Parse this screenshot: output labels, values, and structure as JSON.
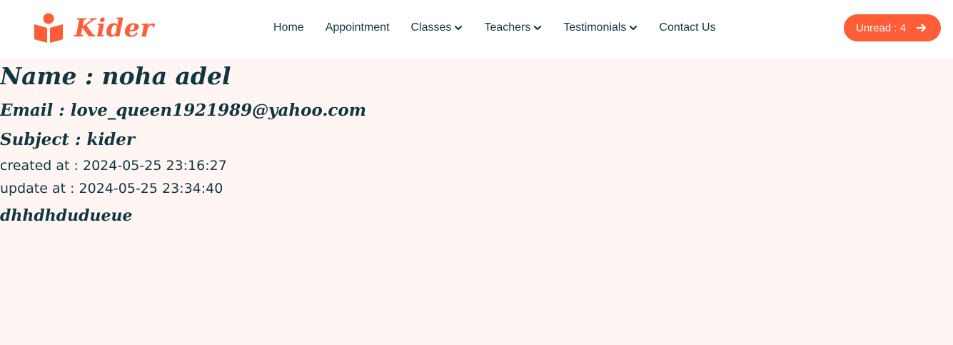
{
  "brand": {
    "name": "Kider",
    "icon": "book-reader-icon",
    "color": "#FE5D37"
  },
  "nav": {
    "items": [
      {
        "label": "Home",
        "dropdown": false
      },
      {
        "label": "Appointment",
        "dropdown": false
      },
      {
        "label": "Classes",
        "dropdown": true
      },
      {
        "label": "Teachers",
        "dropdown": true
      },
      {
        "label": "Testimonials",
        "dropdown": true
      },
      {
        "label": "Contact Us",
        "dropdown": false
      }
    ]
  },
  "unread_button": {
    "label": "Unread : 4",
    "icon": "arrow-right-icon"
  },
  "message": {
    "name_line": "Name : noha adel",
    "email_line": "Email : love_queen1921989@yahoo.com",
    "subject_line": "Subject : kider",
    "created_line": "created at : 2024-05-25 23:16:27",
    "updated_line": "update at : 2024-05-25 23:34:40",
    "body": "dhhdhdudueue"
  },
  "colors": {
    "accent": "#FE5D37",
    "text": "#103741",
    "page_background": "#FFF5F3",
    "navbar_background": "#FFFFFF"
  }
}
